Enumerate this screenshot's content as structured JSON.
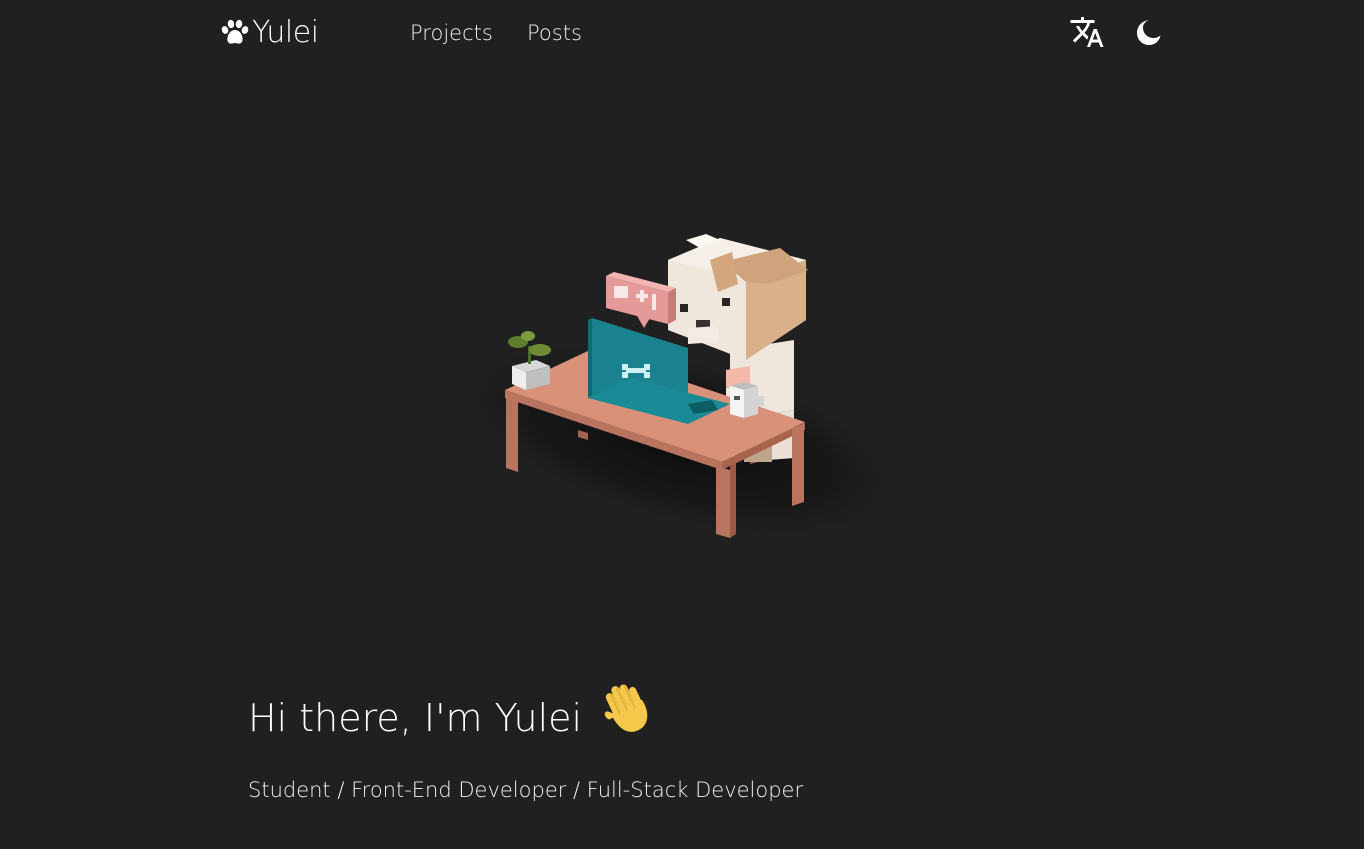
{
  "nav": {
    "logo_text": "Yulei",
    "links": [
      {
        "label": "Projects"
      },
      {
        "label": "Posts"
      }
    ],
    "icons": {
      "logo": "paw-icon",
      "translate": "translate-icon",
      "theme": "moon-icon"
    }
  },
  "hero": {
    "greeting": "Hi there, I'm Yulei",
    "greeting_emoji": "waving-hand-icon",
    "subtitle": "Student / Front-End Developer / Full-Stack Developer"
  },
  "colors": {
    "background": "#202020",
    "text": "#f2f2f2",
    "desk": "#d9917a",
    "laptop": "#1a8a96",
    "dog_light": "#efe6dc",
    "dog_tan": "#d7b38c"
  }
}
